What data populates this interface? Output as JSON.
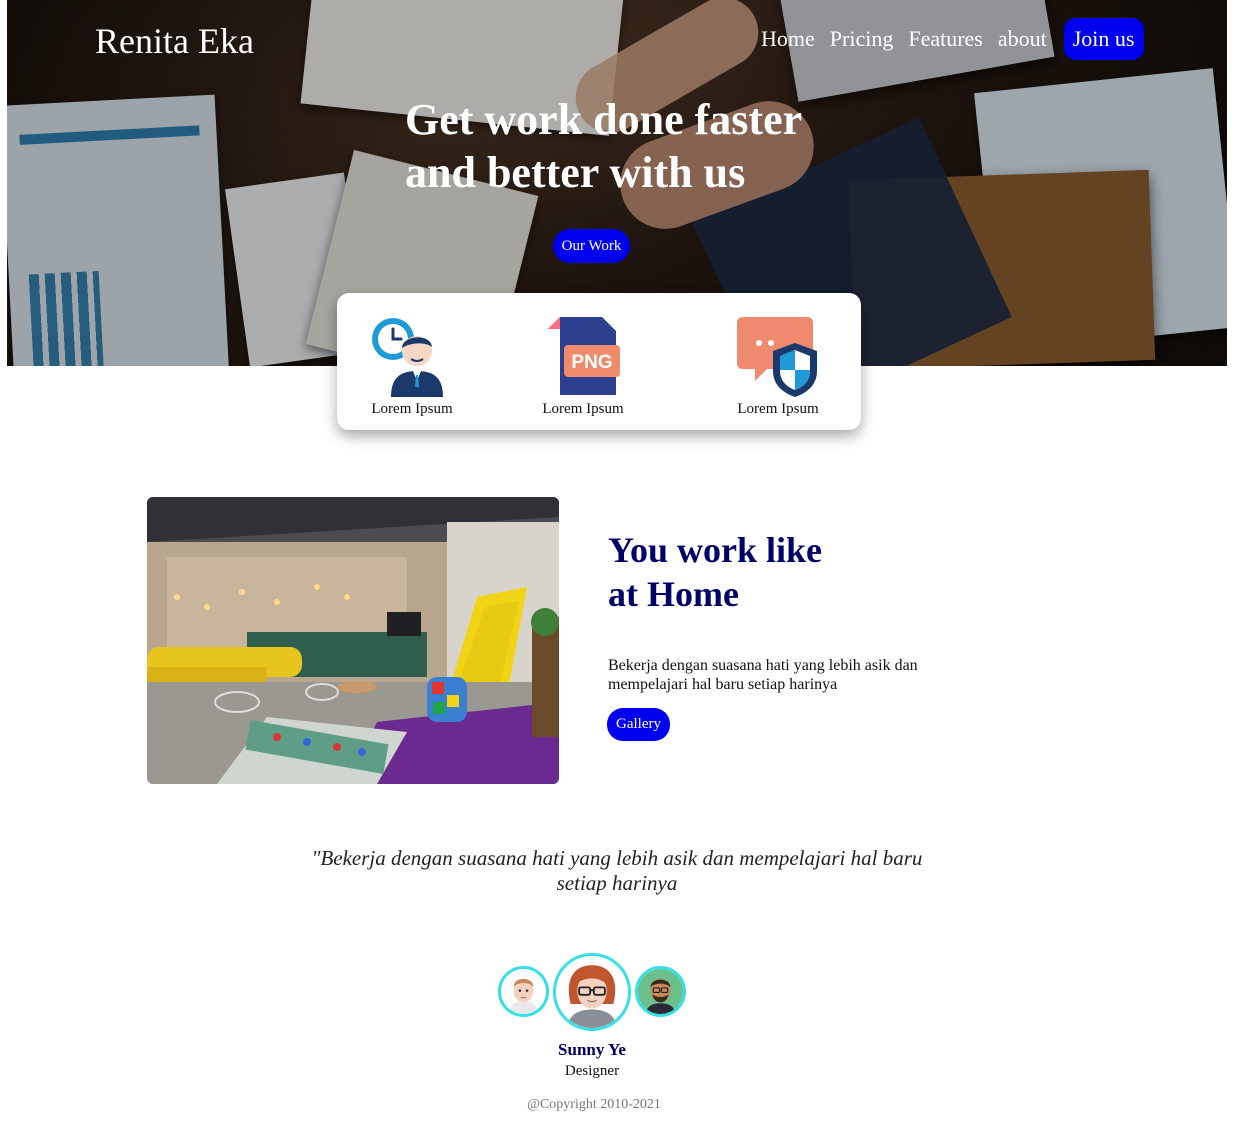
{
  "header": {
    "logo": "Renita Eka",
    "nav": [
      "Home",
      "Pricing",
      "Features",
      "about"
    ],
    "join_label": "Join us"
  },
  "hero": {
    "line1_normal": "Get work done ",
    "line1_bold": "faster",
    "line2_normal_a": "and ",
    "line2_bold": "better",
    "line2_normal_b": " with us",
    "button_label": "Our Work"
  },
  "features": [
    {
      "icon": "clock-person-icon",
      "label": "Lorem Ipsum"
    },
    {
      "icon": "png-file-icon",
      "label": "Lorem Ipsum"
    },
    {
      "icon": "chat-shield-icon",
      "label": "Lorem Ipsum"
    }
  ],
  "about": {
    "title_a": "You ",
    "title_bold_1": "work",
    "title_b": " like",
    "title_c": "at ",
    "title_bold_2": "Home",
    "description": "Bekerja dengan suasana hati yang lebih asik dan mempelajari hal baru setiap harinya",
    "button_label": "Gallery"
  },
  "testimonial": {
    "quote": "\"Bekerja dengan suasana hati yang lebih asik dan mempelajari hal baru setiap harinya",
    "name": "Sunny Ye",
    "role": "Designer"
  },
  "footer": {
    "copyright": "@Copyright 2010-2021"
  },
  "colors": {
    "accent": "#0000ee",
    "heading": "#000066",
    "avatar_ring": "#33e0e6"
  }
}
